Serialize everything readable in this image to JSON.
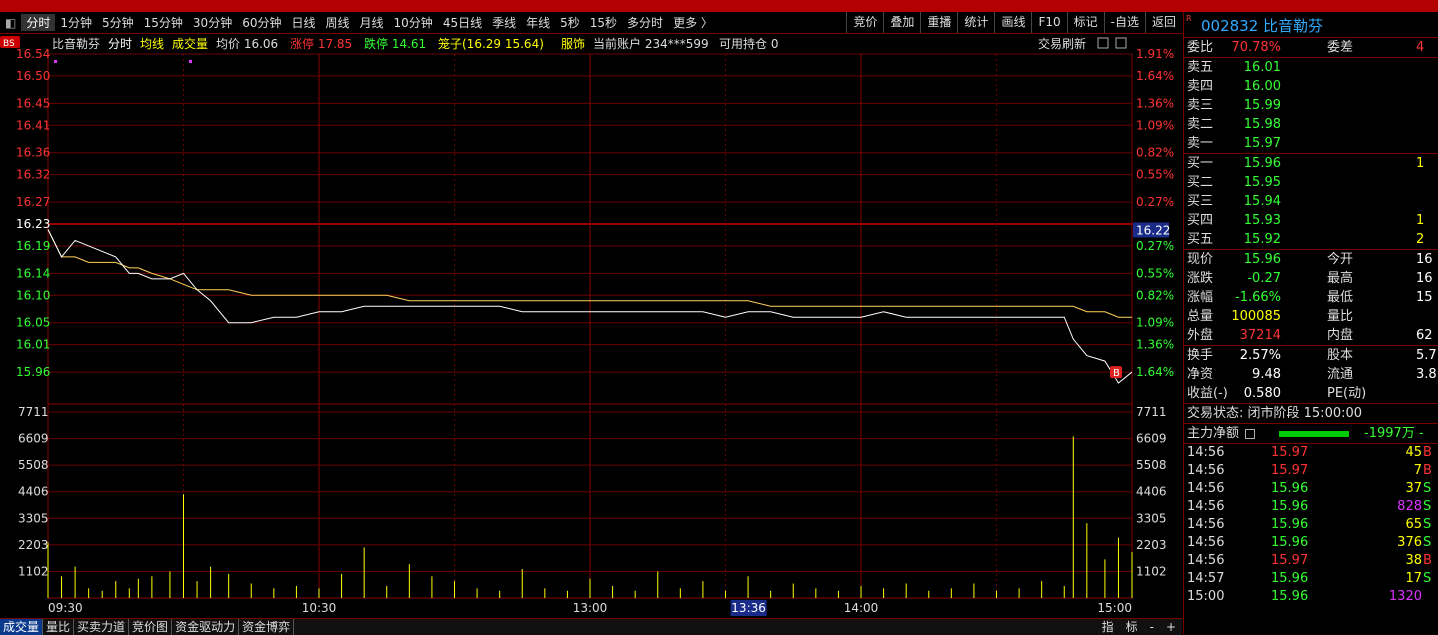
{
  "toolbar": {
    "timeframes": [
      "分时",
      "1分钟",
      "5分钟",
      "15分钟",
      "30分钟",
      "60分钟",
      "日线",
      "周线",
      "月线",
      "10分钟",
      "45日线",
      "季线",
      "年线",
      "5秒",
      "15秒",
      "多分时",
      "更多 〉"
    ],
    "active_index": 0,
    "right_buttons": [
      "竞价",
      "叠加",
      "重播",
      "统计",
      "画线",
      "F10",
      "标记",
      "-自选",
      "返回"
    ]
  },
  "info_bar": {
    "stock_name": "比音勒芬",
    "tag_fenshi": "分时",
    "tag_junxian": "均线",
    "tag_volume": "成交量",
    "avg_label": "均价",
    "avg_value": "16.06",
    "limit_up_label": "涨停",
    "limit_up_value": "17.85",
    "limit_down_label": "跌停",
    "limit_down_value": "14.61",
    "cage_label": "笼子",
    "cage_value": "(16.29 15.64)",
    "sector": "服饰",
    "account_label": "当前账户",
    "account_value": "234***599",
    "holding_label": "可用持仓",
    "holding_value": "0",
    "trade_refresh": "交易刷新",
    "bs_badge": "BS"
  },
  "chart_data": {
    "type": "line",
    "title": "比音勒芬 分时",
    "price_ticks_left": [
      "16.54",
      "16.50",
      "16.45",
      "16.41",
      "16.36",
      "16.32",
      "16.27",
      "16.23",
      "16.19",
      "16.14",
      "16.10",
      "16.05",
      "16.01",
      "15.96"
    ],
    "pct_ticks_right": [
      "1.91%",
      "1.64%",
      "1.36%",
      "1.09%",
      "0.82%",
      "0.55%",
      "0.27%",
      "",
      "0.27%",
      "0.55%",
      "0.82%",
      "1.09%",
      "1.36%",
      "1.64%"
    ],
    "ylim": [
      15.92,
      16.54
    ],
    "prev_close": 16.23,
    "current_price_label": "16.22",
    "volume_ticks": [
      "7711",
      "6609",
      "5508",
      "4406",
      "3305",
      "2203",
      "1102"
    ],
    "volume_ylim": [
      0,
      7711
    ],
    "time_labels": [
      "09:30",
      "10:30",
      "13:00",
      "14:00",
      "15:00"
    ],
    "cursor_time": "13:36",
    "x_minutes": [
      0,
      3,
      6,
      9,
      12,
      15,
      18,
      20,
      23,
      27,
      30,
      33,
      36,
      40,
      45,
      50,
      55,
      60,
      65,
      70,
      75,
      80,
      85,
      90,
      95,
      100,
      105,
      110,
      115,
      120,
      125,
      130,
      135,
      140,
      145,
      150,
      155,
      160,
      165,
      170,
      175,
      180,
      185,
      190,
      195,
      200,
      205,
      210,
      215,
      220,
      225,
      227,
      230,
      234,
      237,
      240
    ],
    "price": [
      16.22,
      16.17,
      16.2,
      16.19,
      16.18,
      16.17,
      16.14,
      16.14,
      16.13,
      16.13,
      16.14,
      16.11,
      16.09,
      16.05,
      16.05,
      16.06,
      16.06,
      16.07,
      16.07,
      16.08,
      16.08,
      16.08,
      16.08,
      16.08,
      16.08,
      16.08,
      16.07,
      16.07,
      16.07,
      16.07,
      16.07,
      16.07,
      16.07,
      16.07,
      16.07,
      16.06,
      16.07,
      16.07,
      16.06,
      16.06,
      16.06,
      16.06,
      16.07,
      16.06,
      16.06,
      16.06,
      16.06,
      16.06,
      16.06,
      16.06,
      16.06,
      16.02,
      15.99,
      15.98,
      15.94,
      15.96
    ],
    "avg": [
      16.22,
      16.17,
      16.17,
      16.16,
      16.16,
      16.16,
      16.15,
      16.15,
      16.14,
      16.13,
      16.12,
      16.11,
      16.11,
      16.11,
      16.1,
      16.1,
      16.1,
      16.1,
      16.1,
      16.1,
      16.1,
      16.09,
      16.09,
      16.09,
      16.09,
      16.09,
      16.09,
      16.09,
      16.09,
      16.09,
      16.09,
      16.09,
      16.09,
      16.09,
      16.09,
      16.09,
      16.09,
      16.08,
      16.08,
      16.08,
      16.08,
      16.08,
      16.08,
      16.08,
      16.08,
      16.08,
      16.08,
      16.08,
      16.08,
      16.08,
      16.08,
      16.08,
      16.07,
      16.07,
      16.06,
      16.06
    ],
    "volume": [
      2300,
      900,
      1300,
      400,
      300,
      700,
      400,
      800,
      900,
      1100,
      4300,
      700,
      1300,
      1000,
      600,
      400,
      500,
      400,
      1000,
      2100,
      500,
      1400,
      900,
      700,
      400,
      300,
      1200,
      400,
      300,
      800,
      500,
      300,
      1100,
      400,
      700,
      300,
      900,
      300,
      600,
      400,
      300,
      500,
      400,
      600,
      300,
      400,
      600,
      300,
      400,
      700,
      500,
      6700,
      3100,
      1600,
      2500,
      1900,
      1300
    ]
  },
  "panel": {
    "r_badge": "R",
    "code_name": "002832 比音勒芬",
    "weibi_label": "委比",
    "weibi_value": "70.78%",
    "weicha_label": "委差",
    "weicha_value": "4",
    "sells": [
      {
        "label": "卖五",
        "price": "16.01"
      },
      {
        "label": "卖四",
        "price": "16.00"
      },
      {
        "label": "卖三",
        "price": "15.99"
      },
      {
        "label": "卖二",
        "price": "15.98"
      },
      {
        "label": "卖一",
        "price": "15.97"
      }
    ],
    "buys": [
      {
        "label": "买一",
        "price": "15.96",
        "vol": "1"
      },
      {
        "label": "买二",
        "price": "15.95",
        "vol": ""
      },
      {
        "label": "买三",
        "price": "15.94",
        "vol": ""
      },
      {
        "label": "买四",
        "price": "15.93",
        "vol": "1"
      },
      {
        "label": "买五",
        "price": "15.92",
        "vol": "2"
      }
    ],
    "stats": [
      {
        "l1": "现价",
        "v1": "15.96",
        "c1": "green",
        "l2": "今开",
        "v2": "16"
      },
      {
        "l1": "涨跌",
        "v1": "-0.27",
        "c1": "green",
        "l2": "最高",
        "v2": "16"
      },
      {
        "l1": "涨幅",
        "v1": "-1.66%",
        "c1": "green",
        "l2": "最低",
        "v2": "15"
      },
      {
        "l1": "总量",
        "v1": "100085",
        "c1": "yellow",
        "l2": "量比",
        "v2": ""
      },
      {
        "l1": "外盘",
        "v1": "37214",
        "c1": "red",
        "l2": "内盘",
        "v2": "62"
      }
    ],
    "stats2": [
      {
        "l1": "换手",
        "v1": "2.57%",
        "l2": "股本",
        "v2": "5.7"
      },
      {
        "l1": "净资",
        "v1": "9.48",
        "l2": "流通",
        "v2": "3.8"
      },
      {
        "l1": "收益(-)",
        "v1": "0.580",
        "l2": "PE(动)",
        "v2": ""
      }
    ],
    "trade_status": "交易状态: 闭市阶段 15:00:00",
    "main_flow_label": "主力净额",
    "main_flow_value": "-1997万 -",
    "ticks": [
      {
        "t": "14:56",
        "p": "15.97",
        "v": "45",
        "bs": "B",
        "pc": "red",
        "vc": "yellow"
      },
      {
        "t": "14:56",
        "p": "15.97",
        "v": "7",
        "bs": "B",
        "pc": "red",
        "vc": "yellow"
      },
      {
        "t": "14:56",
        "p": "15.96",
        "v": "37",
        "bs": "S",
        "pc": "green",
        "vc": "yellow"
      },
      {
        "t": "14:56",
        "p": "15.96",
        "v": "828",
        "bs": "S",
        "pc": "green",
        "vc": "magenta"
      },
      {
        "t": "14:56",
        "p": "15.96",
        "v": "65",
        "bs": "S",
        "pc": "green",
        "vc": "yellow"
      },
      {
        "t": "14:56",
        "p": "15.96",
        "v": "376",
        "bs": "S",
        "pc": "green",
        "vc": "yellow"
      },
      {
        "t": "14:56",
        "p": "15.97",
        "v": "38",
        "bs": "B",
        "pc": "red",
        "vc": "yellow"
      },
      {
        "t": "14:57",
        "p": "15.96",
        "v": "17",
        "bs": "S",
        "pc": "green",
        "vc": "yellow"
      },
      {
        "t": "15:00",
        "p": "15.96",
        "v": "1320",
        "bs": "",
        "pc": "green",
        "vc": "magenta"
      }
    ]
  },
  "bottom_tabs": [
    "成交量",
    "量比",
    "买卖力道",
    "竞价图",
    "资金驱动力",
    "资金博弈"
  ],
  "bottom_active": 0,
  "bottom_controls": [
    "指",
    "标",
    "-",
    "+"
  ]
}
